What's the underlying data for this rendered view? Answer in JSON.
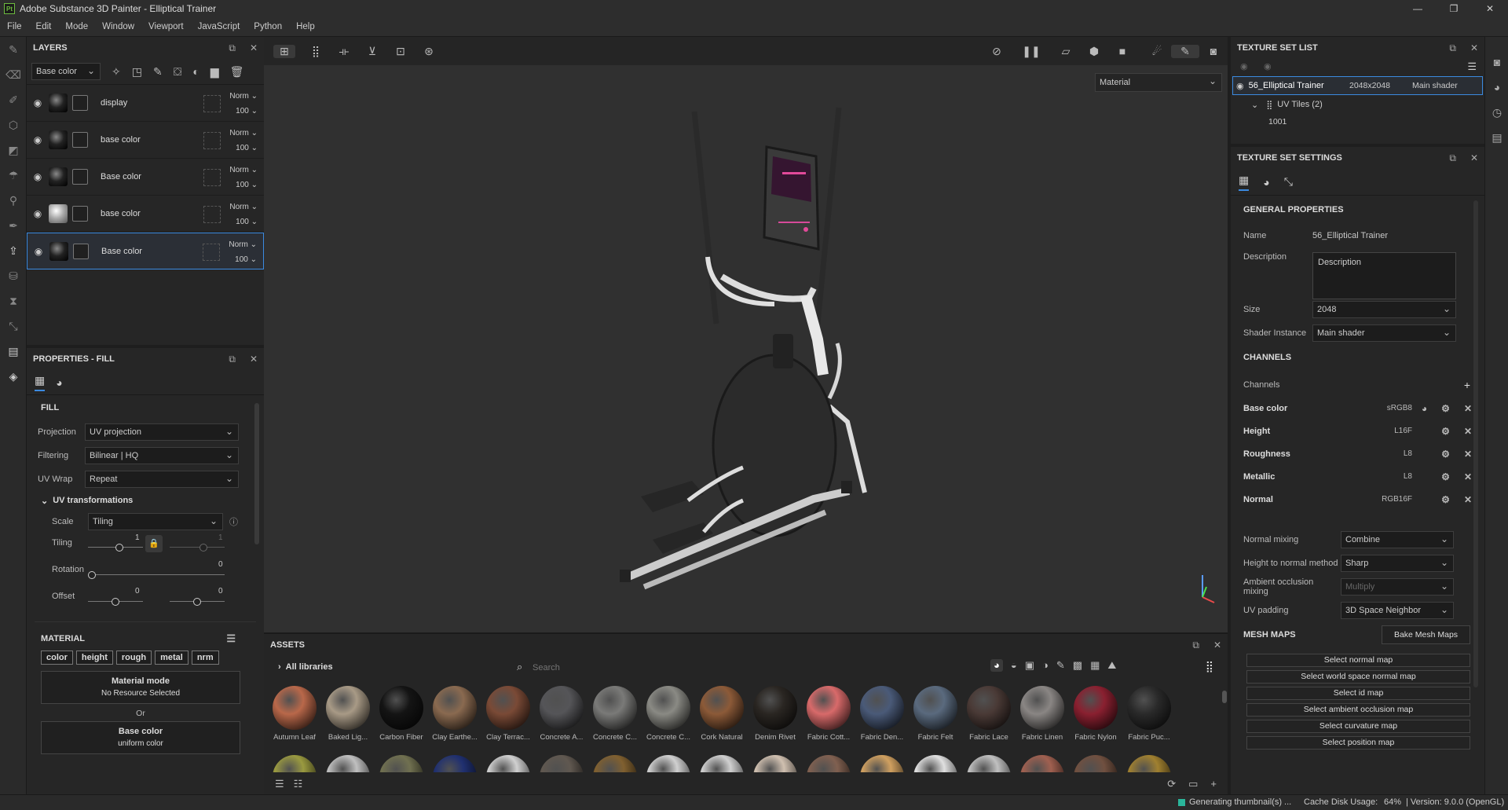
{
  "app": {
    "title": "Adobe Substance 3D Painter - Elliptical Trainer",
    "logo": "Pt"
  },
  "menu": [
    "File",
    "Edit",
    "Mode",
    "Window",
    "Viewport",
    "JavaScript",
    "Python",
    "Help"
  ],
  "layers": {
    "title": "LAYERS",
    "channel_select": "Base color",
    "items": [
      {
        "name": "display",
        "blend": "Norm",
        "opacity": "100",
        "ball": "dark"
      },
      {
        "name": "base color",
        "blend": "Norm",
        "opacity": "100",
        "ball": "dark"
      },
      {
        "name": "Base color",
        "blend": "Norm",
        "opacity": "100",
        "ball": "dark"
      },
      {
        "name": "base color",
        "blend": "Norm",
        "opacity": "100",
        "ball": "light"
      },
      {
        "name": "Base color",
        "blend": "Norm",
        "opacity": "100",
        "ball": "dark"
      }
    ]
  },
  "properties": {
    "title": "PROPERTIES - FILL",
    "fill_label": "FILL",
    "projection_label": "Projection",
    "projection": "UV projection",
    "filtering_label": "Filtering",
    "filtering": "Bilinear | HQ",
    "uvwrap_label": "UV Wrap",
    "uvwrap": "Repeat",
    "uvt_label": "UV transformations",
    "scale_label": "Scale",
    "scale": "Tiling",
    "tiling_label": "Tiling",
    "tiling_value": "1",
    "tiling_value2": "1",
    "rotation_label": "Rotation",
    "rotation_value": "0",
    "offset_label": "Offset",
    "offset_x": "0",
    "offset_y": "0",
    "material_label": "MATERIAL",
    "chips": [
      "color",
      "height",
      "rough",
      "metal",
      "nrm"
    ],
    "material_mode": "Material mode",
    "no_resource": "No Resource Selected",
    "or": "Or",
    "base_color": "Base color",
    "uniform": "uniform color"
  },
  "viewport": {
    "mode_select": "Material"
  },
  "assets": {
    "title": "ASSETS",
    "libraries": "All libraries",
    "search_placeholder": "Search",
    "materials": [
      {
        "name": "Autumn Leaf",
        "color": "#b9684a"
      },
      {
        "name": "Baked Lig...",
        "color": "#a89a86"
      },
      {
        "name": "Carbon Fiber",
        "color": "#141414"
      },
      {
        "name": "Clay Earthe...",
        "color": "#8a6a50"
      },
      {
        "name": "Clay Terrac...",
        "color": "#7a4a36"
      },
      {
        "name": "Concrete A...",
        "color": "#555558"
      },
      {
        "name": "Concrete C...",
        "color": "#7a7a78"
      },
      {
        "name": "Concrete C...",
        "color": "#8a8a84"
      },
      {
        "name": "Cork Natural",
        "color": "#8c5a38"
      },
      {
        "name": "Denim Rivet",
        "color": "#2a2622"
      },
      {
        "name": "Fabric Cott...",
        "color": "#d86a6a"
      },
      {
        "name": "Fabric Den...",
        "color": "#4a5a78"
      },
      {
        "name": "Fabric Felt",
        "color": "#5a6a7e"
      },
      {
        "name": "Fabric Lace",
        "color": "#4a3a36"
      },
      {
        "name": "Fabric Linen",
        "color": "#8a8684"
      },
      {
        "name": "Fabric Nylon",
        "color": "#8a2030"
      },
      {
        "name": "Fabric Puc...",
        "color": "#2a2a2a"
      }
    ],
    "row2_colors": [
      "#9a9a40",
      "#c0c0c0",
      "#707050",
      "#203070",
      "#d0d0d0",
      "#605850",
      "#806030",
      "#d0d0d0",
      "#d0d0d0",
      "#d0c0b0",
      "#806050",
      "#d0a060",
      "#e0e0e0",
      "#c0c0c0",
      "#a06050",
      "#705040",
      "#a08030"
    ]
  },
  "texture_set_list": {
    "title": "TEXTURE SET LIST",
    "set_name": "56_Elliptical Trainer",
    "resolution": "2048x2048",
    "shader": "Main shader",
    "uv_tiles": "UV Tiles (2)",
    "tile": "1001"
  },
  "texture_set_settings": {
    "title": "TEXTURE SET SETTINGS",
    "general": "GENERAL PROPERTIES",
    "name_label": "Name",
    "name": "56_Elliptical Trainer",
    "desc_label": "Description",
    "desc": "Description",
    "size_label": "Size",
    "size": "2048",
    "shader_label": "Shader Instance",
    "shader": "Main shader",
    "channels_title": "CHANNELS",
    "channels_label": "Channels",
    "channels": [
      {
        "name": "Base color",
        "format": "sRGB8"
      },
      {
        "name": "Height",
        "format": "L16F"
      },
      {
        "name": "Roughness",
        "format": "L8"
      },
      {
        "name": "Metallic",
        "format": "L8"
      },
      {
        "name": "Normal",
        "format": "RGB16F"
      }
    ],
    "normal_mixing_label": "Normal mixing",
    "normal_mixing": "Combine",
    "htn_label": "Height to normal method",
    "htn": "Sharp",
    "ao_label": "Ambient occlusion mixing",
    "ao": "Multiply",
    "uvpad_label": "UV padding",
    "uvpad": "3D Space Neighbor",
    "mesh_maps": "MESH MAPS",
    "bake": "Bake Mesh Maps",
    "maps": [
      "Select normal map",
      "Select world space normal map",
      "Select id map",
      "Select ambient occlusion map",
      "Select curvature map",
      "Select position map"
    ]
  },
  "status": {
    "generating": "Generating thumbnail(s) ...",
    "cache": "Cache Disk Usage:",
    "cache_pct": "64%",
    "version": "| Version: 9.0.0 (OpenGL)"
  }
}
